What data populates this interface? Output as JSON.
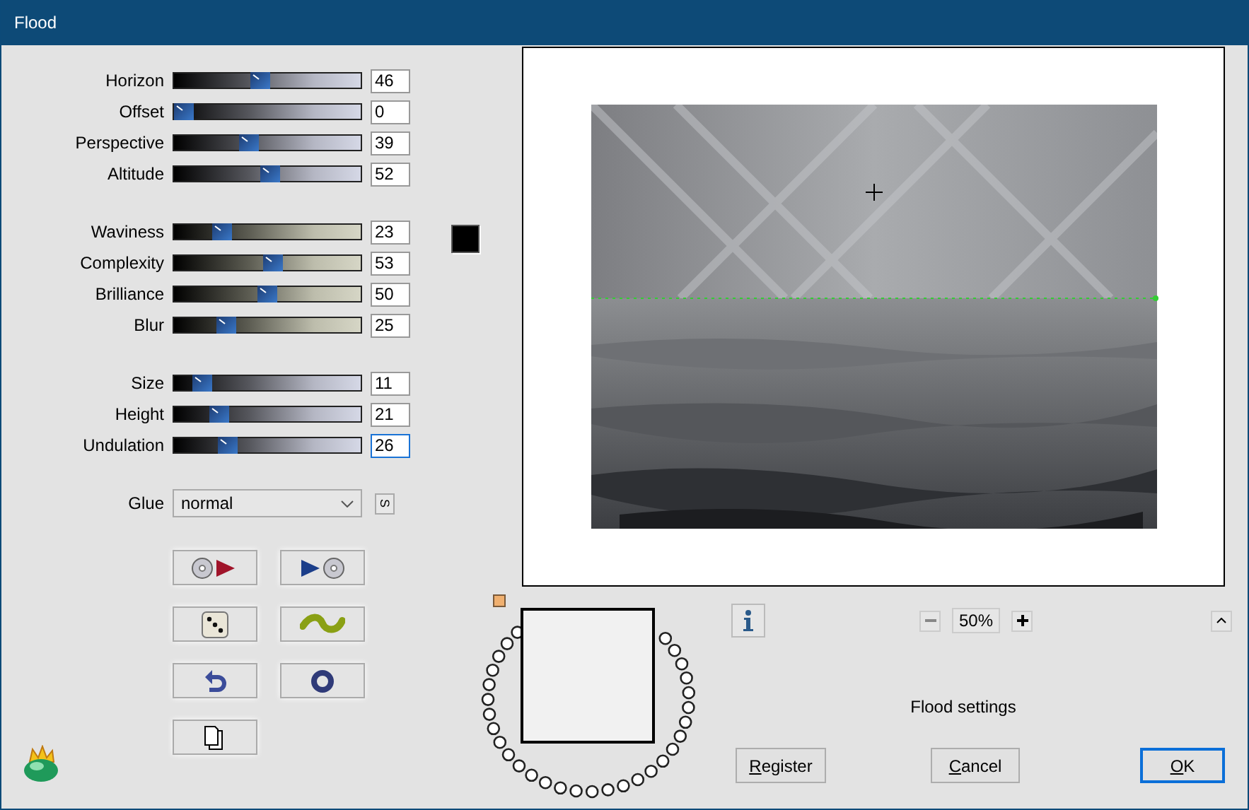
{
  "window": {
    "title": "Flood"
  },
  "slider_groups": [
    {
      "kind": "cool",
      "sliders": [
        {
          "label": "Horizon",
          "value": "46",
          "level": 0.46,
          "focused": false
        },
        {
          "label": "Offset",
          "value": "0",
          "level": 0,
          "focused": false
        },
        {
          "label": "Perspective",
          "value": "39",
          "level": 0.39,
          "focused": false
        },
        {
          "label": "Altitude",
          "value": "52",
          "level": 0.52,
          "focused": false
        }
      ]
    },
    {
      "kind": "warm",
      "swatch": {
        "color": "#000000"
      },
      "sliders": [
        {
          "label": "Waviness",
          "value": "23",
          "level": 0.23,
          "focused": false
        },
        {
          "label": "Complexity",
          "value": "53",
          "level": 0.53,
          "focused": false
        },
        {
          "label": "Brilliance",
          "value": "50",
          "level": 0.5,
          "focused": false
        },
        {
          "label": "Blur",
          "value": "25",
          "level": 0.25,
          "focused": false
        }
      ]
    },
    {
      "kind": "cool",
      "sliders": [
        {
          "label": "Size",
          "value": "11",
          "level": 0.11,
          "focused": false
        },
        {
          "label": "Height",
          "value": "21",
          "level": 0.21,
          "focused": false
        },
        {
          "label": "Undulation",
          "value": "26",
          "level": 0.26,
          "focused": true
        }
      ]
    }
  ],
  "glue": {
    "label": "Glue",
    "value": "normal",
    "button": "S"
  },
  "zoom": {
    "value": "50%"
  },
  "status": "Flood settings",
  "buttons": [
    {
      "label": "Register",
      "default": false
    },
    {
      "label": "Cancel",
      "default": false
    },
    {
      "label": "OK",
      "default": true
    }
  ]
}
